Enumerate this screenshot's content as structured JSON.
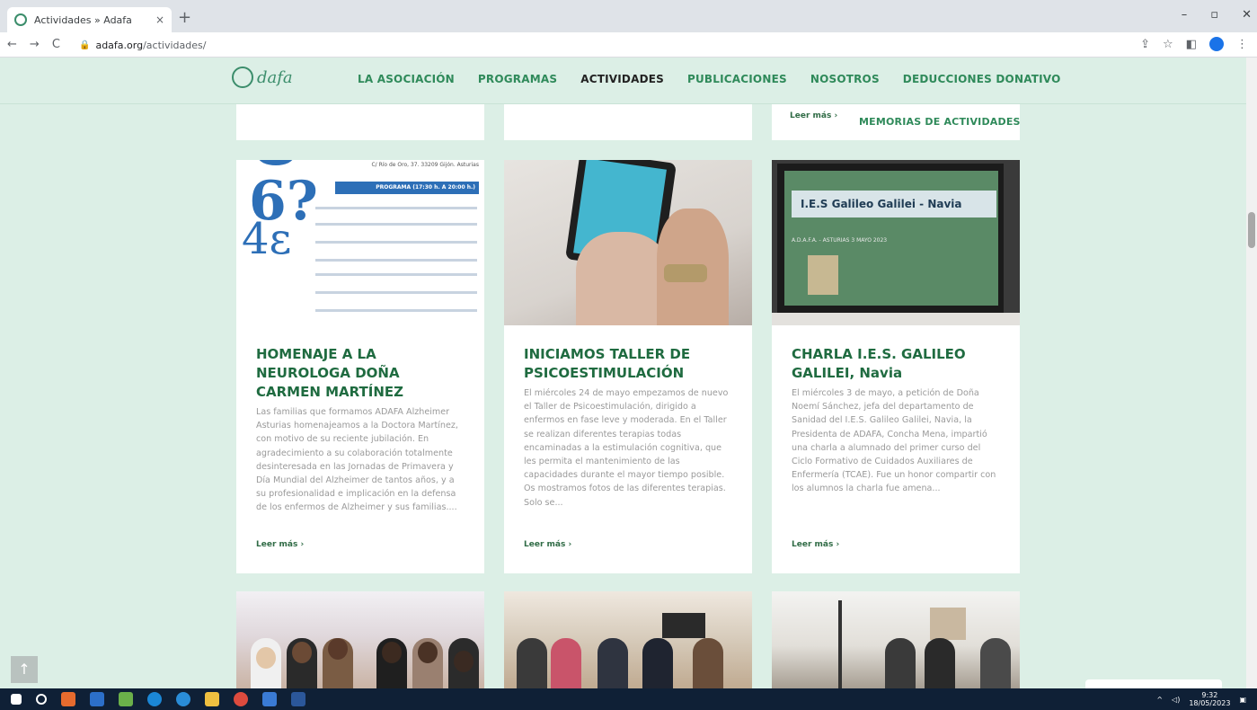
{
  "browser": {
    "tab_title": "Actividades » Adafa",
    "tab_close": "×",
    "new_tab": "+",
    "url_domain": "adafa.org",
    "url_path": "/actividades/",
    "nav_back": "←",
    "nav_forward": "→",
    "nav_reload": "C",
    "win_minimize": "–",
    "win_restore": "▫",
    "win_close": "✕"
  },
  "site": {
    "logo_text": "dafa",
    "nav": [
      {
        "label": "LA ASOCIACIÓN"
      },
      {
        "label": "PROGRAMAS"
      },
      {
        "label": "ACTIVIDADES"
      },
      {
        "label": "PUBLICACIONES"
      },
      {
        "label": "NOSOTROS"
      },
      {
        "label": "DEDUCCIONES DONATIVO"
      }
    ],
    "prev_leer_mas": "Leer más ›",
    "memorias_link": "MEMORIAS DE ACTIVIDADES"
  },
  "cards": [
    {
      "title": "HOMENAJE A LA NEUROLOGA DOÑA CARMEN MARTÍNEZ",
      "excerpt": "Las familias que formamos ADAFA Alzheimer Asturias homenajeamos a la Doctora Martínez, con motivo de su reciente jubilación. En agradecimiento a su colaboración totalmente desinteresada en las Jornadas de Primavera y Día Mundial del Alzheimer de tantos años, y a su profesionalidad e implicación en la defensa de los enfermos de Alzheimer y sus familias....",
      "more": "Leer más ›",
      "img_address": "C/ Río de Oro, 37. 33209 Gijón. Asturias",
      "img_programa": "PROGRAMA (17:30 h. A 20:00 h.)"
    },
    {
      "title": "INICIAMOS TALLER DE PSICOESTIMULACIÓN",
      "excerpt": "El miércoles 24 de mayo empezamos de nuevo el Taller de Psicoestimulación, dirigido a enfermos en fase leve y moderada. En el Taller se realizan diferentes terapias todas encaminadas a la estimulación cognitiva, que les permita el mantenimiento de las capacidades durante el mayor tiempo posible. Os mostramos fotos de las diferentes terapias. Solo se...",
      "more": "Leer más ›"
    },
    {
      "title": "CHARLA I.E.S. GALILEO GALILEI, Navia",
      "excerpt": "El miércoles 3 de mayo, a petición de Doña Noemí Sánchez, jefa del departamento de Sanidad del I.E.S. Galileo Galilei, Navia, la Presidenta de ADAFA, Concha Mena, impartió una charla a alumnado del primer curso del Ciclo Formativo de Cuidados Auxiliares de Enfermería (TCAE). Fue un honor compartir con los alumnos la charla fue amena...",
      "more": "Leer más ›",
      "img_slide_title": "I.E.S Galileo Galilei - Navia",
      "img_slide_sub": "A.D.A.F.A. - ASTURIAS     3 MAYO 2023"
    }
  ],
  "taskbar": {
    "time": "9:32",
    "date": "18/05/2023"
  },
  "colors": {
    "background": "#dcefe6",
    "nav_green": "#2f8a5a",
    "title_green": "#1f6b40"
  }
}
